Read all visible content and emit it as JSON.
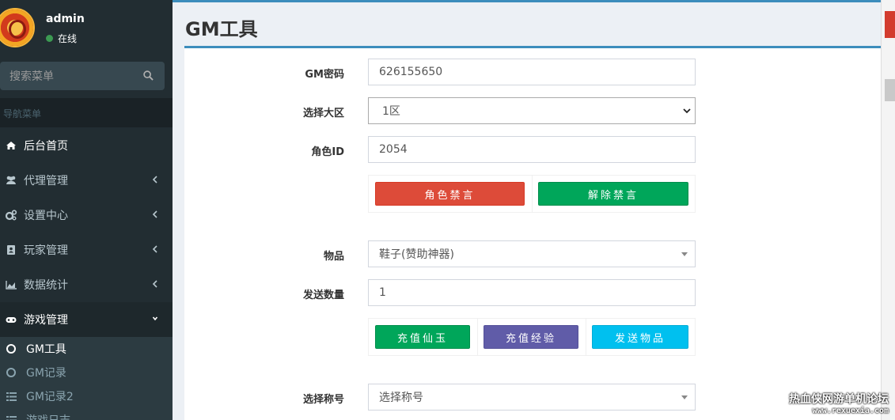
{
  "user": {
    "name": "admin",
    "status": "在线"
  },
  "sidebar": {
    "search_placeholder": "搜索菜单",
    "nav_header": "导航菜单",
    "items": [
      {
        "label": "后台首页",
        "icon": "home-icon"
      },
      {
        "label": "代理管理",
        "icon": "users-icon"
      },
      {
        "label": "设置中心",
        "icon": "gears-icon"
      },
      {
        "label": "玩家管理",
        "icon": "address-book-icon"
      },
      {
        "label": "数据统计",
        "icon": "area-chart-icon"
      },
      {
        "label": "游戏管理",
        "icon": "gamepad-icon"
      }
    ],
    "subitems": [
      {
        "label": "GM工具"
      },
      {
        "label": "GM记录"
      },
      {
        "label": "GM记录2"
      },
      {
        "label": "游戏日志"
      }
    ]
  },
  "page": {
    "title": "GM工具"
  },
  "form": {
    "password_label": "GM密码",
    "password_value": "626155650",
    "zone_label": "选择大区",
    "zone_value": "1区",
    "role_label": "角色ID",
    "role_value": "2054",
    "ban_button": "角色禁言",
    "unban_button": "解除禁言",
    "item_label": "物品",
    "item_value": "鞋子(赞助神器)",
    "count_label": "发送数量",
    "count_value": "1",
    "recharge_jade_button": "充值仙玉",
    "recharge_exp_button": "充值经验",
    "send_item_button": "发送物品",
    "title_label": "选择称号",
    "title_value": "选择称号"
  },
  "watermark": {
    "line1": "热血侠网游单机论坛",
    "line2": "www.rexuexia.com"
  },
  "colors": {
    "accent": "#3c8dbc",
    "sidebar_bg": "#222d32",
    "danger": "#dd4b39",
    "success": "#00a65a",
    "purple": "#605ca8",
    "info": "#00c0ef"
  }
}
